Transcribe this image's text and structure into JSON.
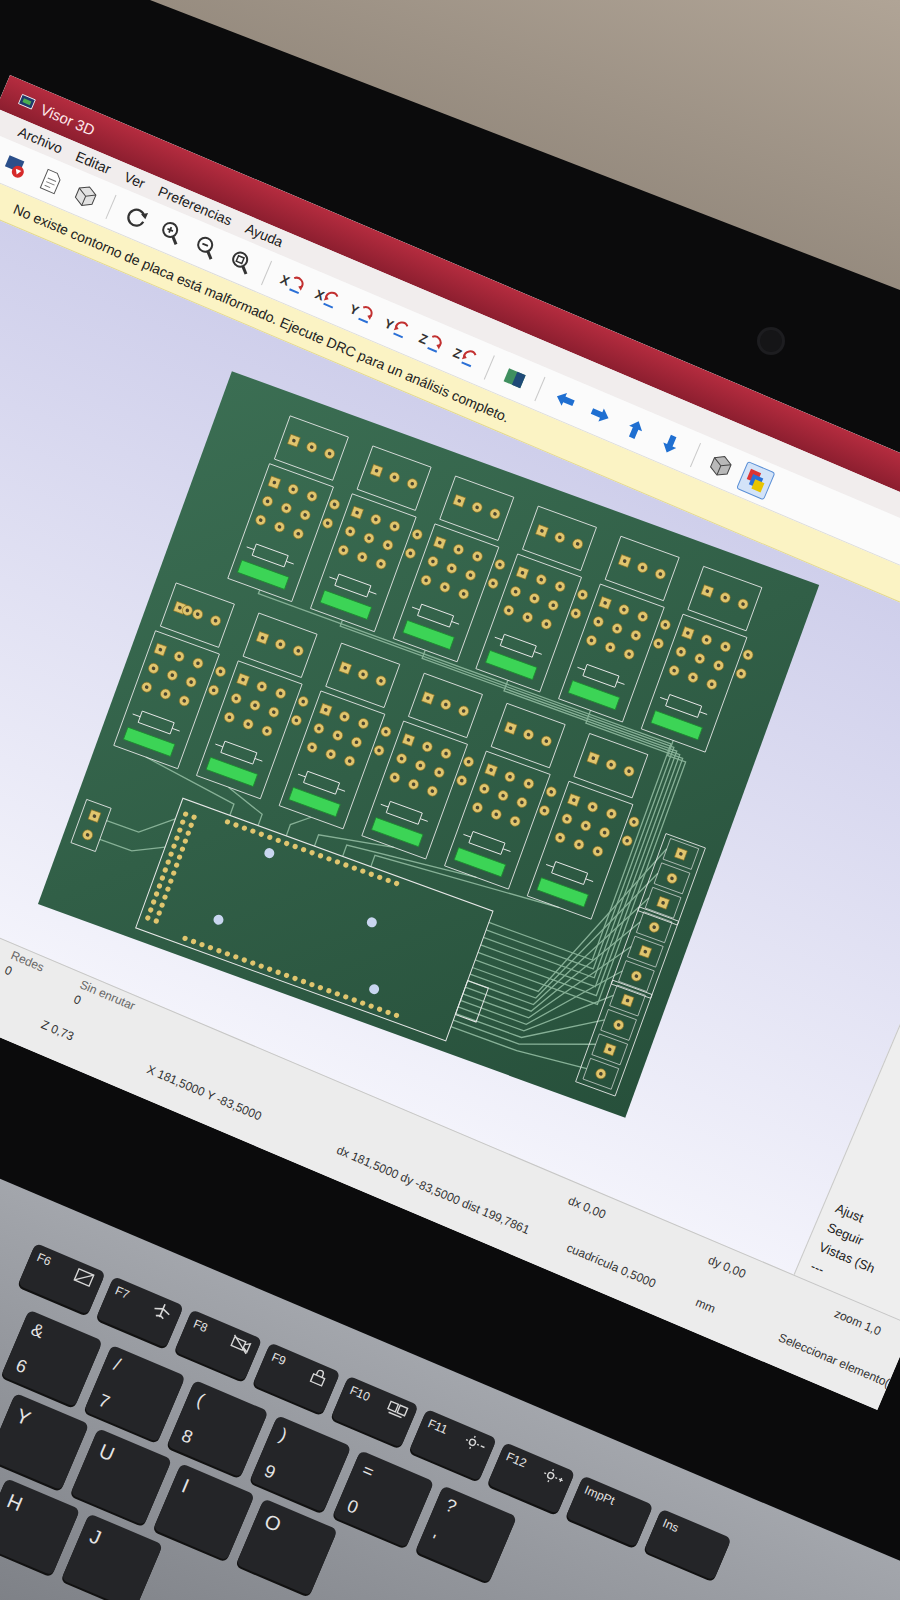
{
  "window": {
    "title": "Visor 3D"
  },
  "menu": [
    "Archivo",
    "Editar",
    "Ver",
    "Preferencias",
    "Ayuda"
  ],
  "toolbar": [
    {
      "kind": "render",
      "selected": false
    },
    {
      "kind": "document",
      "selected": false
    },
    {
      "kind": "cube",
      "selected": false
    },
    {
      "kind": "refresh",
      "selected": false
    },
    {
      "kind": "zoomin",
      "selected": false
    },
    {
      "kind": "zoomout",
      "selected": false
    },
    {
      "kind": "zoomfit",
      "selected": false
    },
    {
      "kind": "rotate",
      "label": "X",
      "selected": false
    },
    {
      "kind": "rotate",
      "label": "X",
      "selected": false
    },
    {
      "kind": "rotate",
      "label": "Y",
      "selected": false
    },
    {
      "kind": "rotate",
      "label": "Y",
      "selected": false
    },
    {
      "kind": "rotate",
      "label": "Z",
      "selected": false
    },
    {
      "kind": "rotate",
      "label": "Z",
      "selected": false
    },
    {
      "kind": "flip",
      "selected": false
    },
    {
      "kind": "left",
      "selected": false
    },
    {
      "kind": "right",
      "selected": false
    },
    {
      "kind": "up",
      "selected": false
    },
    {
      "kind": "down",
      "selected": false
    },
    {
      "kind": "ortho",
      "selected": false
    },
    {
      "kind": "layers",
      "selected": true
    }
  ],
  "warning": "No existe contorno de placa está malformado. Ejecute DRC para un análisis completo.",
  "side_panel": [
    "Ajust",
    "Seguir",
    "Vistas (Sh",
    "---"
  ],
  "status_bar": {
    "nets_label": "Redes",
    "nets": "0",
    "unrouted_label": "Sin enrutar",
    "unrouted": "0",
    "dx": "dx 0,00",
    "dy": "dy 0,00",
    "zoom": "zoom 1,0",
    "z": "Z 0,73",
    "xy": "X 181,5000 Y -83,5000",
    "delta": "dx 181,5000 dy -83,5000 dist 199,7861",
    "grid": "cuadrícula 0,5000",
    "units": "mm",
    "hint": "Seleccionar elemento(s)"
  },
  "keyboard": {
    "fn_row": [
      {
        "label": "F6",
        "kind": "touchpad"
      },
      {
        "label": "F7",
        "kind": "airplane"
      },
      {
        "label": "F8",
        "kind": "camera"
      },
      {
        "label": "F9",
        "kind": "lock"
      },
      {
        "label": "F10",
        "kind": "display"
      },
      {
        "label": "F11",
        "kind": "dimmer"
      },
      {
        "label": "F12",
        "kind": "brighter"
      },
      {
        "label": "ImpPt",
        "kind": "plain"
      },
      {
        "label": "Ins",
        "kind": "plain"
      }
    ],
    "number_row": [
      {
        "top": "&",
        "bottom": "6"
      },
      {
        "top": "/",
        "bottom": "7"
      },
      {
        "top": "(",
        "bottom": "8"
      },
      {
        "top": ")",
        "bottom": "9"
      },
      {
        "top": "=",
        "bottom": "0"
      },
      {
        "top": "?",
        "bottom": "'"
      }
    ],
    "letter_row": [
      "Y",
      "U",
      "I",
      "O"
    ],
    "home_row": [
      "H",
      "J"
    ]
  }
}
